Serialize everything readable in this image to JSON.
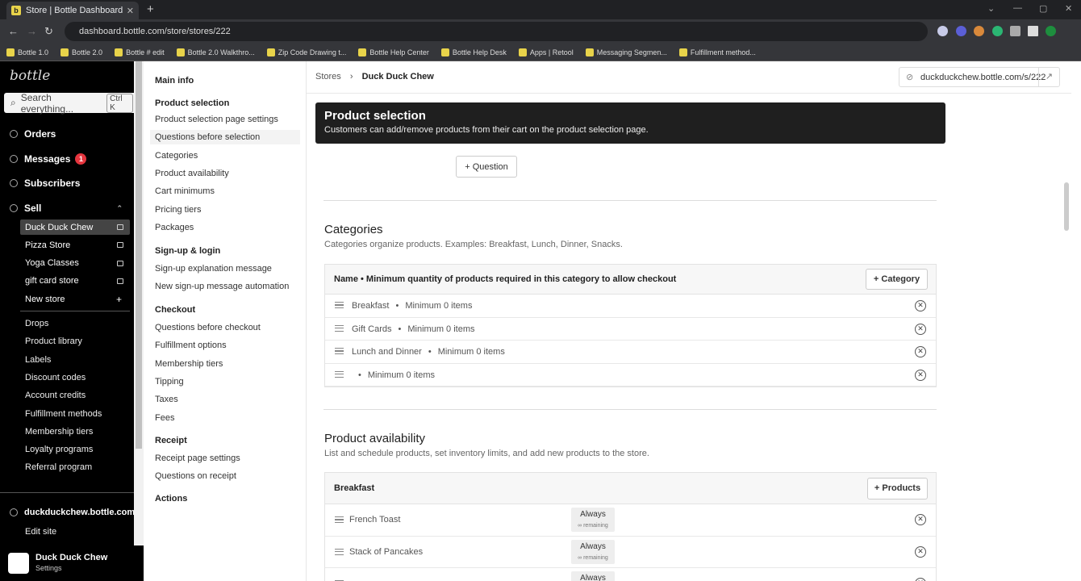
{
  "browser": {
    "tab_title": "Store | Bottle Dashboard",
    "url": "dashboard.bottle.com/store/stores/222",
    "bookmarks": [
      "Bottle 1.0",
      "Bottle 2.0",
      "Bottle # edit",
      "Bottle 2.0 Walkthro...",
      "Zip Code Drawing t...",
      "Bottle Help Center",
      "Bottle Help Desk",
      "Apps | Retool",
      "Messaging Segmen...",
      "Fulfillment method..."
    ]
  },
  "sidebar": {
    "logo": "bottle",
    "search_placeholder": "Search everything...",
    "search_shortcut": "Ctrl K",
    "orders": "Orders",
    "messages": "Messages",
    "messages_count": "1",
    "subscribers": "Subscribers",
    "sell": "Sell",
    "stores": [
      "Duck Duck Chew",
      "Pizza Store",
      "Yoga Classes",
      "gift card store"
    ],
    "new_store": "New store",
    "items": [
      "Drops",
      "Product library",
      "Labels",
      "Discount codes",
      "Account credits",
      "Fulfillment methods",
      "Membership tiers",
      "Loyalty programs",
      "Referral program"
    ],
    "site_domain": "duckduckchew.bottle.com",
    "edit_site": "Edit site",
    "footer_name": "Duck Duck Chew",
    "footer_sub": "Settings"
  },
  "subnav": {
    "main_info": "Main info",
    "product_selection": "Product selection",
    "ps_items": [
      "Product selection page settings",
      "Questions before selection",
      "Categories",
      "Product availability",
      "Cart minimums",
      "Pricing tiers",
      "Packages"
    ],
    "signup": "Sign-up & login",
    "signup_items": [
      "Sign-up explanation message",
      "New sign-up message automation"
    ],
    "checkout": "Checkout",
    "checkout_items": [
      "Questions before checkout",
      "Fulfillment options",
      "Membership tiers",
      "Tipping",
      "Taxes",
      "Fees"
    ],
    "receipt": "Receipt",
    "receipt_items": [
      "Receipt page settings",
      "Questions on receipt"
    ],
    "actions": "Actions"
  },
  "main": {
    "breadcrumb_root": "Stores",
    "breadcrumb_current": "Duck Duck Chew",
    "store_url": "duckduckchew.bottle.com/s/222",
    "ps_title": "Product selection",
    "ps_desc": "Customers can add/remove products from their cart on the product selection page.",
    "question_btn": "+ Question",
    "cat_title": "Categories",
    "cat_desc": "Categories organize products. Examples: Breakfast, Lunch, Dinner, Snacks.",
    "cat_header": "Name  •  Minimum quantity of products required in this category to allow checkout",
    "category_btn": "+ Category",
    "categories": [
      {
        "name": "Breakfast",
        "min": "Minimum 0 items"
      },
      {
        "name": "Gift Cards",
        "min": "Minimum 0 items"
      },
      {
        "name": "Lunch and Dinner",
        "min": "Minimum 0 items"
      },
      {
        "name": "",
        "min": "Minimum 0 items"
      }
    ],
    "pa_title": "Product availability",
    "pa_desc": "List and schedule products, set inventory limits, and add new products to the store.",
    "pa_group": "Breakfast",
    "products_btn": "+ Products",
    "products": [
      {
        "name": "French Toast",
        "avail": "Always",
        "rem": "∞ remaining"
      },
      {
        "name": "Stack of Pancakes",
        "avail": "Always",
        "rem": "∞ remaining"
      },
      {
        "name": "",
        "avail": "Always",
        "rem": ""
      }
    ]
  }
}
